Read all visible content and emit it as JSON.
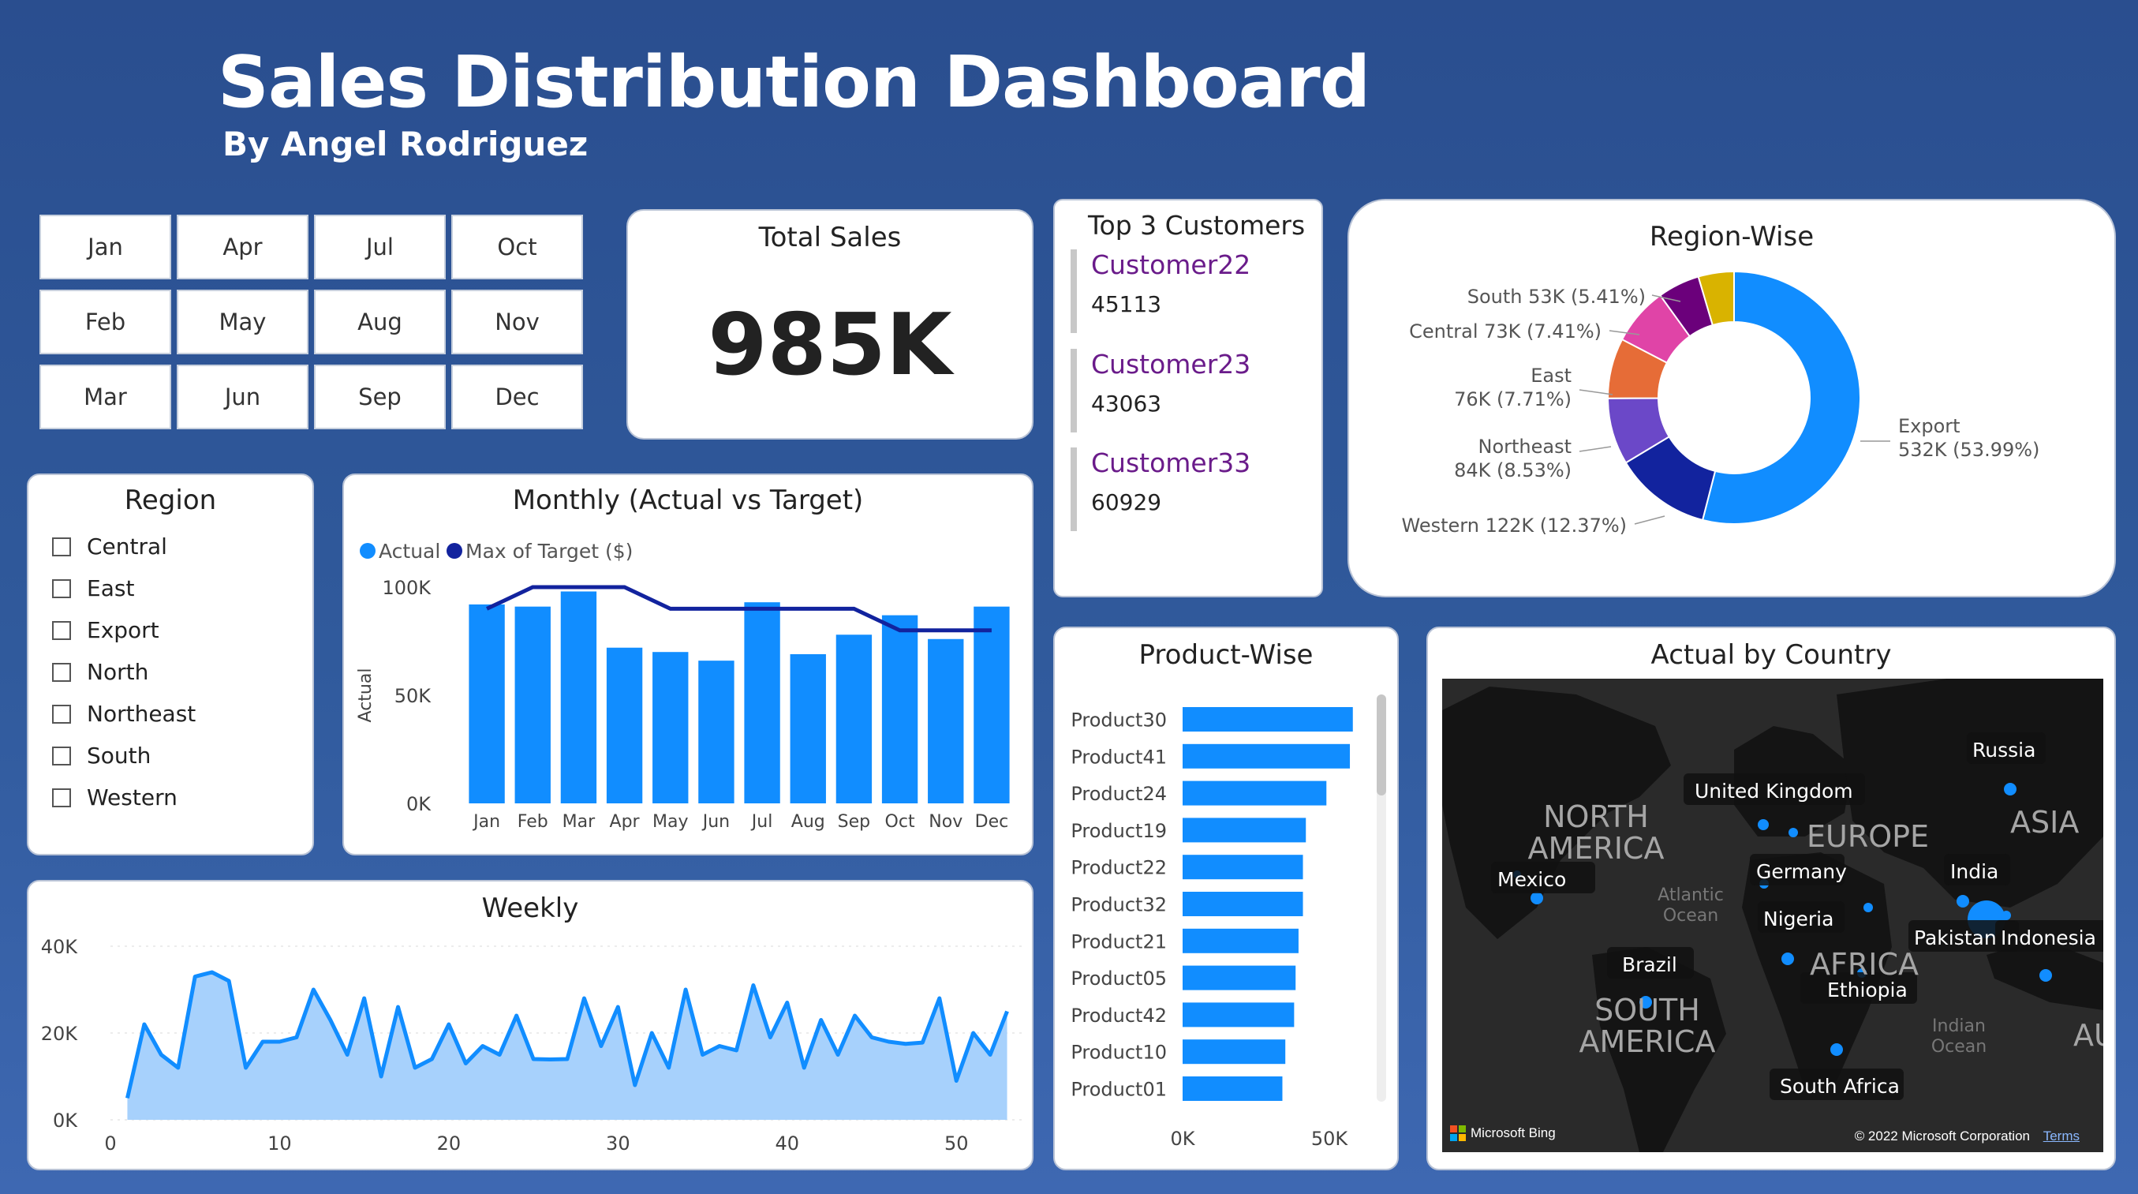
{
  "header": {
    "title": "Sales Distribution Dashboard",
    "byline": "By Angel Rodriguez"
  },
  "months": [
    "Jan",
    "Apr",
    "Jul",
    "Oct",
    "Feb",
    "May",
    "Aug",
    "Nov",
    "Mar",
    "Jun",
    "Sep",
    "Dec"
  ],
  "total_sales": {
    "title": "Total Sales",
    "value": "985K"
  },
  "top_customers": {
    "title": "Top 3 Customers",
    "items": [
      {
        "name": "Customer22",
        "value": "45113"
      },
      {
        "name": "Customer23",
        "value": "43063"
      },
      {
        "name": "Customer33",
        "value": "60929"
      }
    ]
  },
  "region_filter": {
    "title": "Region",
    "options": [
      "Central",
      "East",
      "Export",
      "North",
      "Northeast",
      "South",
      "Western"
    ]
  },
  "map": {
    "title": "Actual by Country",
    "labels": [
      "Russia",
      "United Kingdom",
      "EUROPE",
      "NORTH AMERICA",
      "ASIA",
      "Mexico",
      "Germany",
      "India",
      "Atlantic Ocean",
      "Nigeria",
      "Pakistan",
      "Indonesia",
      "Brazil",
      "AFRICA",
      "Ethiopia",
      "SOUTH AMERICA",
      "Indian Ocean",
      "South Africa",
      "AU"
    ],
    "attribution": "Microsoft Bing",
    "copyright": "© 2022 Microsoft Corporation",
    "terms": "Terms"
  },
  "colors": {
    "bar": "#118dff",
    "target": "#12239e",
    "area_fill": "#a7d1fc",
    "card_border": "#b9c3d6",
    "purple": "#6a1b8a"
  },
  "chart_data": [
    {
      "type": "bar",
      "title": "Monthly (Actual vs Target)",
      "legend": [
        "Actual",
        "Max of Target ($)"
      ],
      "legend_position": "top-left",
      "ylabel": "Actual",
      "categories": [
        "Jan",
        "Feb",
        "Mar",
        "Apr",
        "May",
        "Jun",
        "Jul",
        "Aug",
        "Sep",
        "Oct",
        "Nov",
        "Dec"
      ],
      "series": [
        {
          "name": "Actual",
          "type": "bar",
          "values": [
            92000,
            91000,
            98000,
            72000,
            70000,
            66000,
            93000,
            69000,
            78000,
            87000,
            76000,
            91000
          ]
        },
        {
          "name": "Max of Target ($)",
          "type": "line",
          "values": [
            90000,
            100000,
            100000,
            100000,
            90000,
            90000,
            90000,
            90000,
            90000,
            80000,
            80000,
            80000
          ]
        }
      ],
      "ylim": [
        0,
        100000
      ],
      "yticks": [
        "100K",
        "50K",
        "0K"
      ]
    },
    {
      "type": "area",
      "title": "Weekly",
      "x": [
        1,
        2,
        3,
        4,
        5,
        6,
        7,
        8,
        9,
        10,
        11,
        12,
        13,
        14,
        15,
        16,
        17,
        18,
        19,
        20,
        21,
        22,
        23,
        24,
        25,
        26,
        27,
        28,
        29,
        30,
        31,
        32,
        33,
        34,
        35,
        36,
        37,
        38,
        39,
        40,
        41,
        42,
        43,
        44,
        45,
        46,
        47,
        48,
        49,
        50,
        51,
        52,
        53
      ],
      "values": [
        5000,
        22000,
        15000,
        12000,
        33000,
        34000,
        32000,
        12000,
        18000,
        18000,
        19000,
        30000,
        23000,
        15000,
        28000,
        10000,
        26000,
        12000,
        14000,
        22000,
        13000,
        17000,
        15000,
        24000,
        14000,
        13900,
        14000,
        28000,
        17000,
        26000,
        8000,
        20000,
        12000,
        30000,
        15000,
        17000,
        16000,
        31000,
        19000,
        27000,
        12000,
        23000,
        15000,
        24000,
        19000,
        18000,
        17500,
        17800,
        28000,
        9000,
        20000,
        15000,
        25000
      ],
      "ylim": [
        0,
        40000
      ],
      "yticks": [
        "40K",
        "20K",
        "0K"
      ],
      "xticks": [
        "0",
        "10",
        "20",
        "30",
        "40",
        "50"
      ]
    },
    {
      "type": "pie",
      "title": "Region-Wise",
      "labels": [
        "Export",
        "Western",
        "Northeast",
        "East",
        "Central",
        "South"
      ],
      "values": [
        532,
        122,
        84,
        76,
        73,
        53
      ],
      "display": [
        "532K (53.99%)",
        "Western 122K (12.37%)",
        "84K (8.53%)",
        "76K (7.71%)",
        "Central 73K (7.41%)",
        "South 53K (5.41%)"
      ],
      "extra_slice": {
        "label": "",
        "value": 45
      },
      "colors": [
        "#118dff",
        "#12239e",
        "#6b48c8",
        "#e66c37",
        "#e044a7",
        "#6b007b",
        "#d9b300"
      ]
    },
    {
      "type": "bar",
      "orientation": "horizontal",
      "title": "Product-Wise",
      "categories": [
        "Product30",
        "Product41",
        "Product24",
        "Product19",
        "Product22",
        "Product32",
        "Product21",
        "Product05",
        "Product42",
        "Product10",
        "Product01"
      ],
      "values": [
        58000,
        57000,
        49000,
        42000,
        41000,
        41000,
        39500,
        38500,
        38000,
        35000,
        34000
      ],
      "xticks": [
        "0K",
        "50K"
      ],
      "xlim": [
        0,
        50000
      ]
    }
  ]
}
